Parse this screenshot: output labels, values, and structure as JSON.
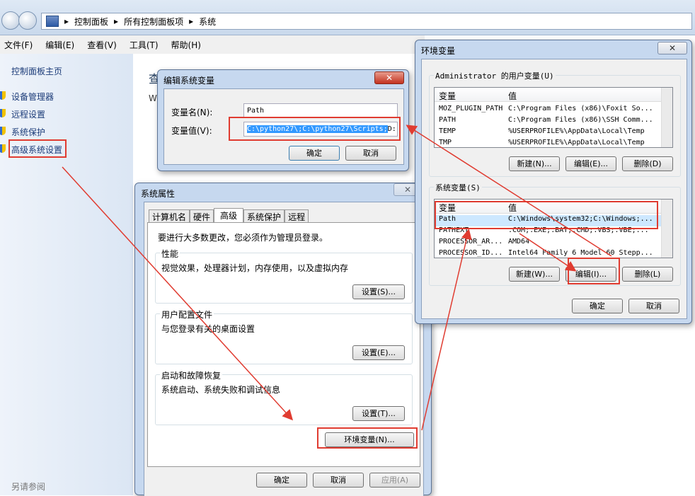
{
  "explorer": {
    "breadcrumb": [
      "控制面板",
      "所有控制面板项",
      "系统"
    ],
    "menu": [
      "文件(F)",
      "编辑(E)",
      "查看(V)",
      "工具(T)",
      "帮助(H)"
    ],
    "leftnav": {
      "home": "控制面板主页",
      "items": [
        "设备管理器",
        "远程设置",
        "系统保护",
        "高级系统设置"
      ],
      "see_also": "另请参阅"
    },
    "bg_heading": "查",
    "bg_sub": "W"
  },
  "sysprops": {
    "title": "系统属性",
    "tabs": [
      "计算机名",
      "硬件",
      "高级",
      "系统保护",
      "远程"
    ],
    "admin_note": "要进行大多数更改，您必须作为管理员登录。",
    "perf_title": "性能",
    "perf_desc": "视觉效果，处理器计划，内存使用，以及虚拟内存",
    "perf_btn": "设置(S)...",
    "profile_title": "用户配置文件",
    "profile_desc": "与您登录有关的桌面设置",
    "profile_btn": "设置(E)...",
    "startup_title": "启动和故障恢复",
    "startup_desc": "系统启动、系统失败和调试信息",
    "startup_btn": "设置(T)...",
    "env_btn": "环境变量(N)...",
    "ok": "确定",
    "cancel": "取消",
    "apply": "应用(A)"
  },
  "editvar": {
    "title": "编辑系统变量",
    "name_label": "变量名(N):",
    "name_value": "Path",
    "value_label": "变量值(V):",
    "value_selected": "C:\\python27\\;C:\\python27\\Scripts;",
    "value_tail": "D:",
    "ok": "确定",
    "cancel": "取消"
  },
  "envvars": {
    "title": "环境变量",
    "user_caption": "Administrator 的用户变量(U)",
    "col_var": "变量",
    "col_val": "值",
    "user_rows": [
      {
        "var": "MOZ_PLUGIN_PATH",
        "val": "C:\\Program Files (x86)\\Foxit So..."
      },
      {
        "var": "PATH",
        "val": "C:\\Program Files (x86)\\SSH Comm..."
      },
      {
        "var": "TEMP",
        "val": "%USERPROFILE%\\AppData\\Local\\Temp"
      },
      {
        "var": "TMP",
        "val": "%USERPROFILE%\\AppData\\Local\\Temp"
      }
    ],
    "user_new": "新建(N)...",
    "user_edit": "编辑(E)...",
    "user_delete": "删除(D)",
    "sys_caption": "系统变量(S)",
    "sys_rows": [
      {
        "var": "Path",
        "val": "C:\\Windows\\system32;C:\\Windows;..."
      },
      {
        "var": "PATHEXT",
        "val": ".COM;.EXE;.BAT;.CMD;.VBS;.VBE;..."
      },
      {
        "var": "PROCESSOR_AR...",
        "val": "AMD64"
      },
      {
        "var": "PROCESSOR_ID...",
        "val": "Intel64 Family 6 Model 60 Stepp..."
      }
    ],
    "sys_new": "新建(W)...",
    "sys_edit": "编辑(I)...",
    "sys_delete": "删除(L)",
    "ok": "确定",
    "cancel": "取消"
  },
  "colors": {
    "annotation_red": "#e03c31",
    "link_blue": "#1b3b78",
    "selection": "#3399ff"
  }
}
